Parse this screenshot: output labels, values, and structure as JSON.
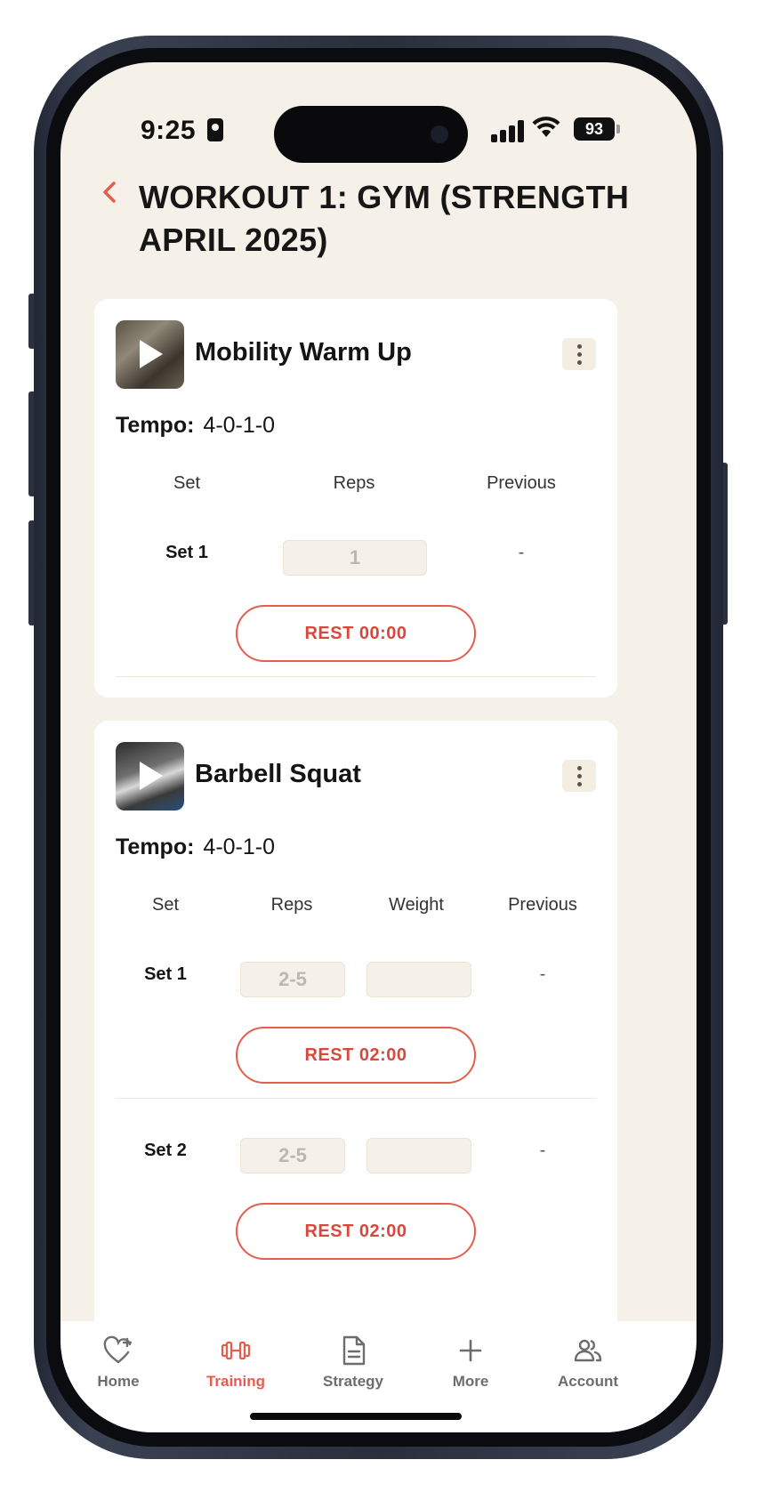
{
  "status_bar": {
    "time": "9:25",
    "battery": "93"
  },
  "header": {
    "back_icon": "chevron-left-icon",
    "title": "WORKOUT 1: GYM (STRENGTH APRIL 2025)"
  },
  "exercises": [
    {
      "name": "Mobility Warm Up",
      "tempo_label": "Tempo:",
      "tempo_value": "4-0-1-0",
      "columns": [
        "Set",
        "Reps",
        "Previous"
      ],
      "sets": [
        {
          "label": "Set 1",
          "reps_placeholder": "1",
          "previous": "-",
          "rest": "REST 00:00"
        }
      ]
    },
    {
      "name": "Barbell Squat",
      "tempo_label": "Tempo:",
      "tempo_value": "4-0-1-0",
      "columns": [
        "Set",
        "Reps",
        "Weight",
        "Previous"
      ],
      "sets": [
        {
          "label": "Set 1",
          "reps_placeholder": "2-5",
          "weight_placeholder": "",
          "previous": "-",
          "rest": "REST 02:00"
        },
        {
          "label": "Set 2",
          "reps_placeholder": "2-5",
          "weight_placeholder": "",
          "previous": "-",
          "rest": "REST 02:00"
        }
      ]
    }
  ],
  "bottom_nav": {
    "active": "Training",
    "accent_color": "#e35e4e",
    "items": [
      {
        "label": "Home",
        "icon": "heart-plus-icon"
      },
      {
        "label": "Training",
        "icon": "dumbbell-icon"
      },
      {
        "label": "Strategy",
        "icon": "document-icon"
      },
      {
        "label": "More",
        "icon": "plus-icon"
      },
      {
        "label": "Account",
        "icon": "users-icon"
      }
    ]
  }
}
